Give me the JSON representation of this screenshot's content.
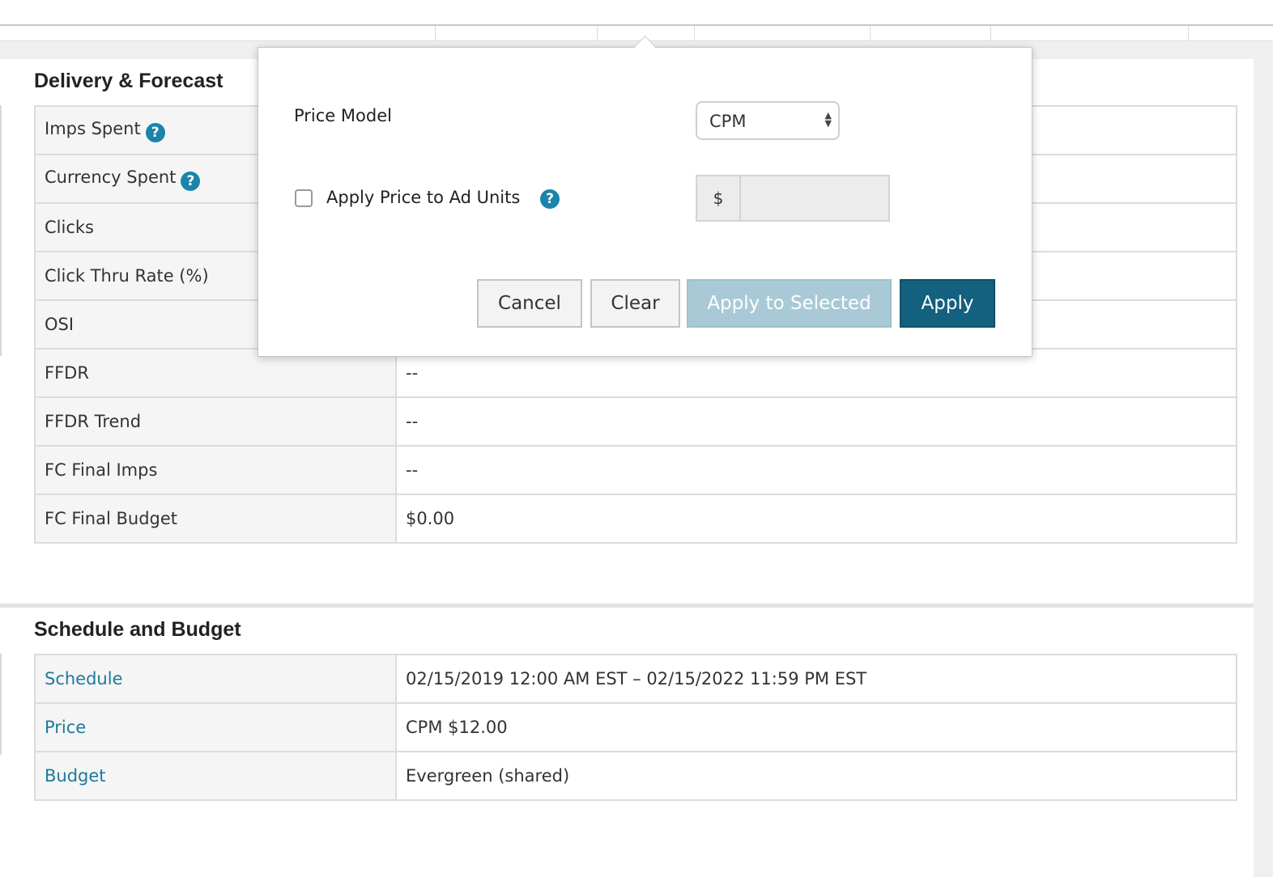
{
  "delivery": {
    "title": "Delivery & Forecast",
    "rows": [
      {
        "label": "Imps Spent",
        "value": "",
        "help": true
      },
      {
        "label": "Currency Spent",
        "value": "",
        "help": true
      },
      {
        "label": "Clicks",
        "value": ""
      },
      {
        "label": "Click Thru Rate (%)",
        "value": ""
      },
      {
        "label": "OSI",
        "value": ""
      },
      {
        "label": "FFDR",
        "value": "--"
      },
      {
        "label": "FFDR Trend",
        "value": "--"
      },
      {
        "label": "FC Final Imps",
        "value": "--"
      },
      {
        "label": "FC Final Budget",
        "value": "$0.00"
      }
    ]
  },
  "schedule": {
    "title": "Schedule and Budget",
    "rows": [
      {
        "label": "Schedule",
        "value": "02/15/2019 12:00 AM EST – 02/15/2022 11:59 PM EST"
      },
      {
        "label": "Price",
        "value": "CPM $12.00"
      },
      {
        "label": "Budget",
        "value": "Evergreen (shared)"
      }
    ]
  },
  "popover": {
    "price_model_label": "Price Model",
    "price_model_value": "CPM",
    "apply_price_label": "Apply Price to Ad Units",
    "currency_symbol": "$",
    "price_value": "",
    "buttons": {
      "cancel": "Cancel",
      "clear": "Clear",
      "apply_selected": "Apply to Selected",
      "apply": "Apply"
    }
  },
  "icons": {
    "help": "?"
  },
  "colors": {
    "link": "#1d7a9c",
    "primary_button": "#14607f",
    "disabled_button": "#a9c9d6",
    "help_icon": "#1b84aa"
  }
}
